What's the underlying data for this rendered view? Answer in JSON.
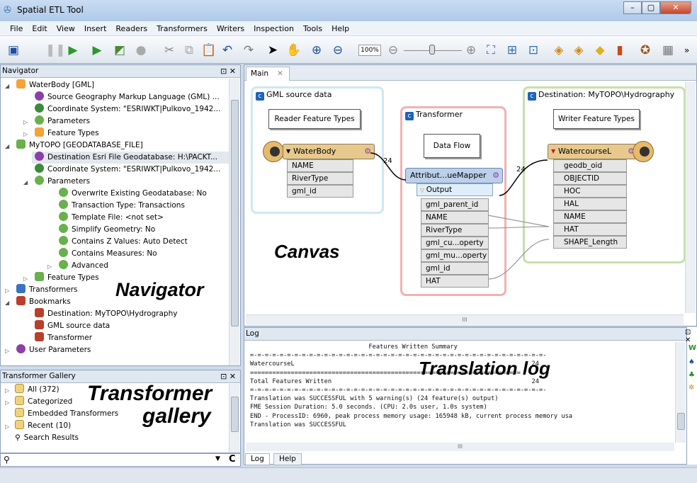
{
  "window": {
    "title": "Spatial ETL Tool",
    "min": "–",
    "max": "▢",
    "close": "✕"
  },
  "menu": [
    "File",
    "Edit",
    "View",
    "Insert",
    "Readers",
    "Transformers",
    "Writers",
    "Inspection",
    "Tools",
    "Help"
  ],
  "toolbar": {
    "zoom": "100%",
    "more": "»"
  },
  "navigator": {
    "title": "Navigator",
    "pin": "⊡ ✕",
    "overlay": "Navigator",
    "items": [
      "WaterBody [GML]",
      "Source Geography Markup Language (GML) ...",
      "Coordinate System: \"ESRIWKT|Pulkovo_1942...",
      "Parameters",
      "Feature Types",
      "MyTOPO [GEODATABASE_FILE]",
      "Destination Esri File Geodatabase: H:\\PACKT...",
      "Coordinate System: \"ESRIWKT|Pulkovo_1942...",
      "Parameters",
      "Overwrite Existing Geodatabase: No",
      "Transaction Type: Transactions",
      "Template File: <not set>",
      "Simplify Geometry: No",
      "Contains Z Values: Auto Detect",
      "Contains Measures: No",
      "Advanced",
      "Feature Types",
      "Transformers",
      "Bookmarks",
      "Destination: MyTOPO\\Hydrography",
      "GML source data",
      "Transformer",
      "User Parameters"
    ]
  },
  "gallery": {
    "title": "Transformer Gallery",
    "pin": "⊡ ✕",
    "overlay1": "Transformer",
    "overlay2": "gallery",
    "items": [
      "All (372)",
      "Categorized",
      "Embedded Transformers",
      "Recent (10)",
      "Search Results"
    ],
    "search_placeholder": "",
    "clear": "C"
  },
  "canvas": {
    "tab": "Main",
    "tab_close": "✕",
    "overlay": "Canvas",
    "bm_source": "GML source data",
    "bm_transformer": "Transformer",
    "bm_dest": "Destination: MyTOPO\\Hydrography",
    "note_reader": "Reader Feature Types",
    "note_flow": "Data Flow",
    "note_writer": "Writer Feature Types",
    "reader": {
      "name": "WaterBody",
      "attrs": [
        "NAME",
        "RiverType",
        "gml_id"
      ]
    },
    "transformer": {
      "name": "Attribut...ueMapper",
      "port": "Output",
      "attrs": [
        "gml_parent_id",
        "NAME",
        "RiverType",
        "gml_cu...operty",
        "gml_mu...operty",
        "gml_id",
        "HAT"
      ]
    },
    "writer": {
      "name": "WatercourseL",
      "attrs": [
        "geodb_oid",
        "OBJECTID",
        "HOC",
        "HAL",
        "NAME",
        "HAT",
        "SHAPE_Length"
      ]
    },
    "count1": "24",
    "count2": "24",
    "hscroll": "III"
  },
  "log": {
    "title": "Log",
    "overlay": "Translation log",
    "pin": "⊡ ✕",
    "lines": [
      "                                Features Written Summary",
      "=-=-=-=-=-=-=-=-=-=-=-=-=-=-=-=-=-=-=-=-=-=-=-=-=-=-=-=-=-=-=-=-=-=-=-=-=-=-=-=-",
      "WatercourseL                                                                24",
      "=========================================================================",
      "Total Features Written                                                      24",
      "=-=-=-=-=-=-=-=-=-=-=-=-=-=-=-=-=-=-=-=-=-=-=-=-=-=-=-=-=-=-=-=-=-=-=-=-=-=-=-=-",
      "Translation was SUCCESSFUL with 5 warning(s) (24 feature(s) output)",
      "FME Session Duration: 5.0 seconds. (CPU: 2.0s user, 1.0s system)",
      "END - ProcessID: 6960, peak process memory usage: 165948 kB, current process memory usa",
      "Translation was SUCCESSFUL"
    ],
    "tabs": [
      "Log",
      "Help"
    ],
    "hscroll": "III"
  }
}
